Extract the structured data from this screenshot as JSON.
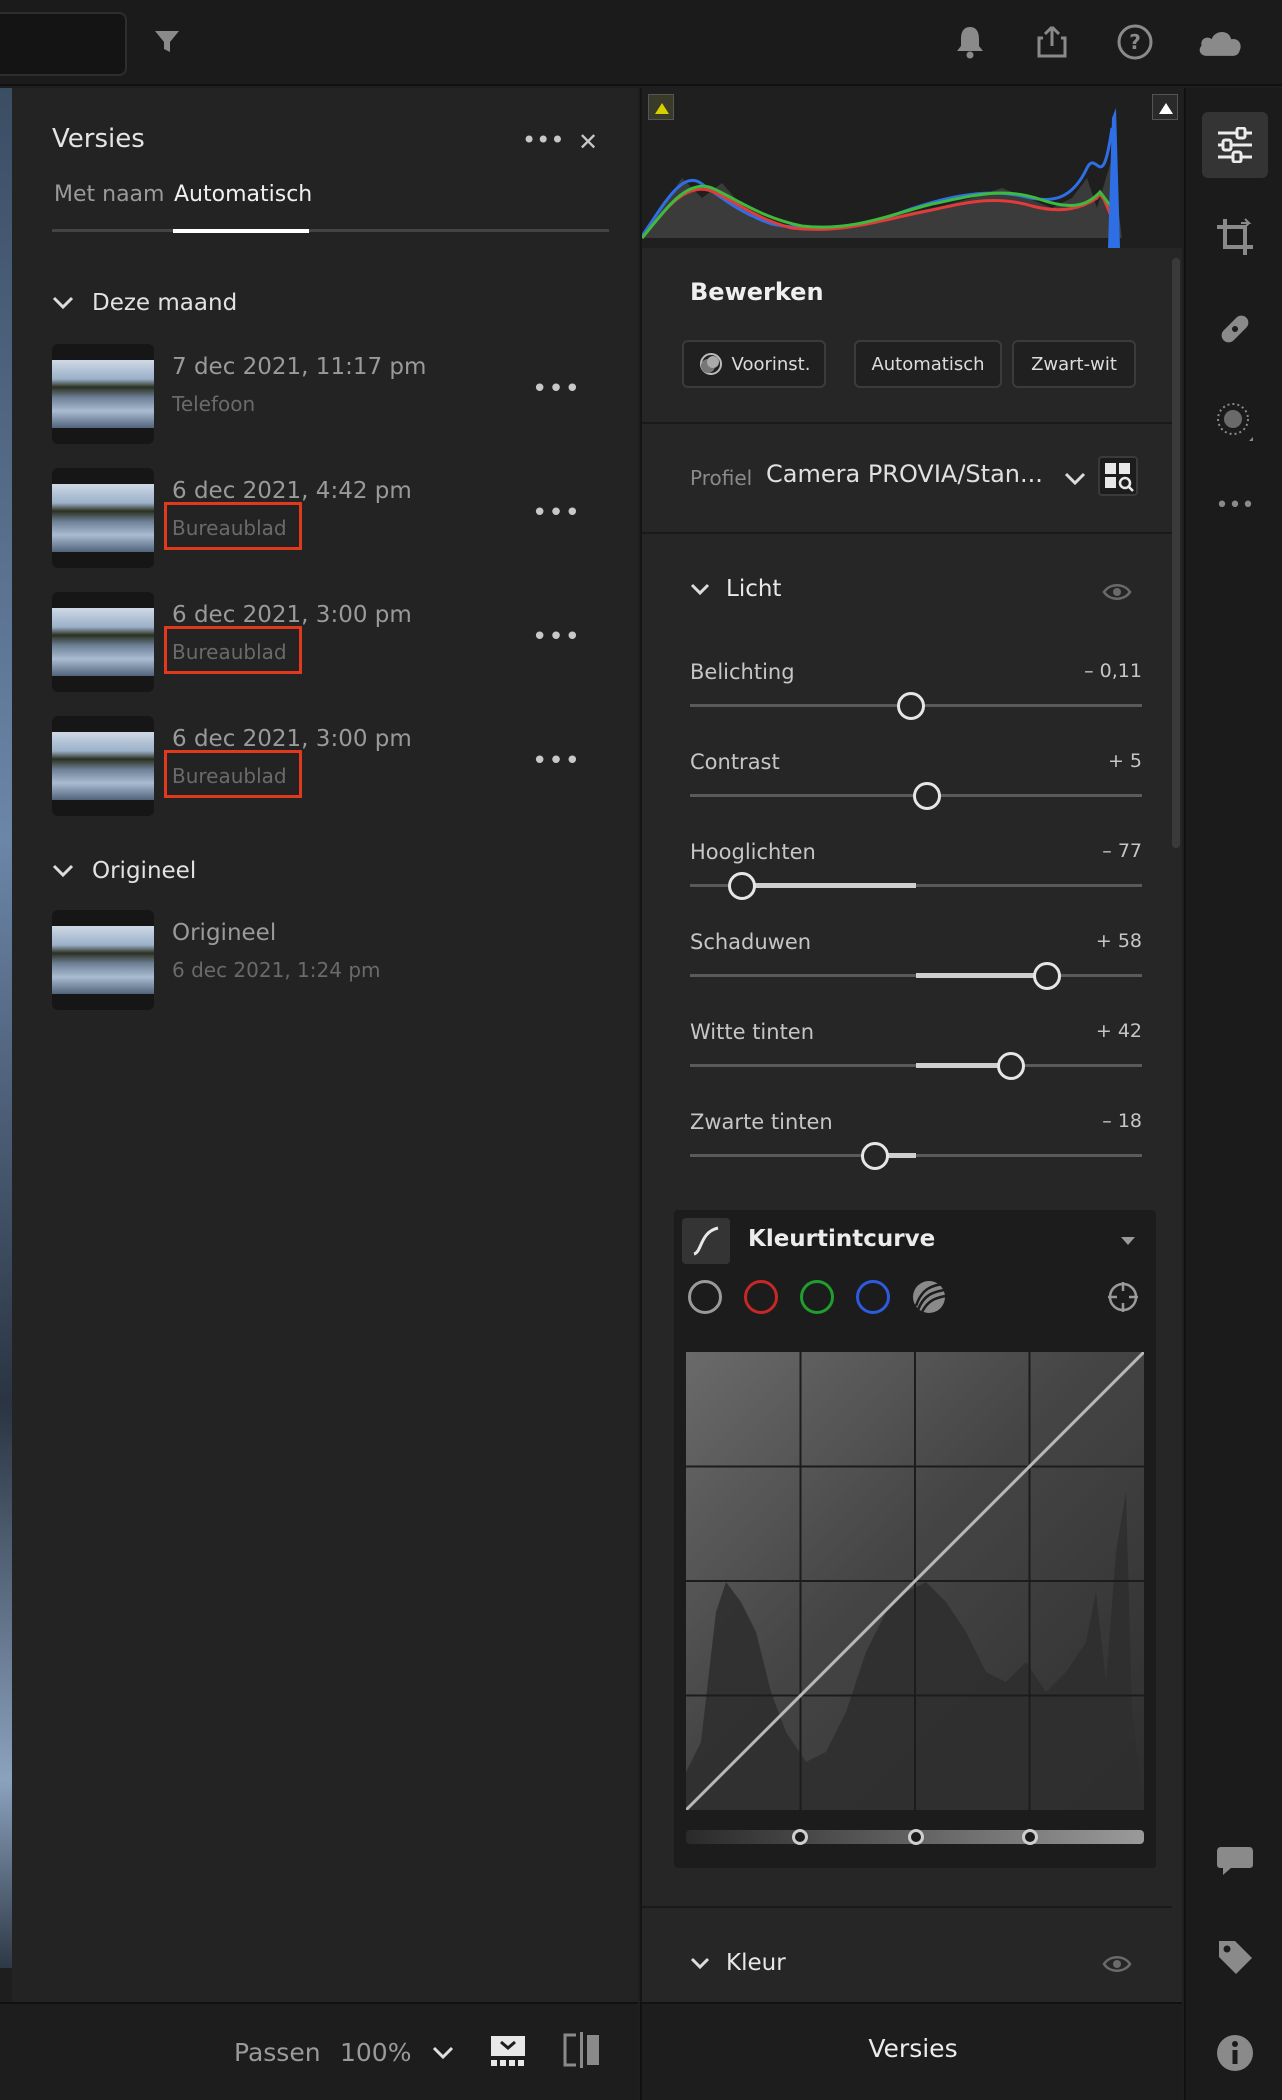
{
  "topbar": {
    "filter_icon": "filter-icon",
    "bell_icon": "bell-icon",
    "share_icon": "share-icon",
    "help_icon": "help-icon",
    "cloud_icon": "cloud-icon"
  },
  "versions": {
    "title": "Versies",
    "more": "•••",
    "close": "✕",
    "tabs": [
      "Met naam",
      "Automatisch"
    ],
    "active_tab": "Automatisch",
    "groups": [
      {
        "label": "Deze maand",
        "items": [
          {
            "date": "7 dec 2021, 11:17 pm",
            "source": "Telefoon",
            "highlighted": false
          },
          {
            "date": "6 dec 2021, 4:42 pm",
            "source": "Bureaublad",
            "highlighted": true
          },
          {
            "date": "6 dec 2021, 3:00 pm",
            "source": "Bureaublad",
            "highlighted": true
          },
          {
            "date": "6 dec 2021, 3:00 pm",
            "source": "Bureaublad",
            "highlighted": true
          }
        ]
      },
      {
        "label": "Origineel",
        "items": [
          {
            "date": "Origineel",
            "source": "6 dec 2021, 1:24 pm",
            "highlighted": false
          }
        ]
      }
    ]
  },
  "bottom_left": {
    "fit_label": "Passen",
    "zoom": "100%"
  },
  "edit": {
    "title": "Bewerken",
    "presets_label": "Voorinst.",
    "auto_label": "Automatisch",
    "bw_label": "Zwart-wit",
    "profile_label": "Profiel",
    "profile_value": "Camera PROVIA/Stan...",
    "light_label": "Licht",
    "sliders": [
      {
        "label": "Belichting",
        "value": "– 0,11",
        "num": -0.11,
        "min": -5,
        "max": 5
      },
      {
        "label": "Contrast",
        "value": "+ 5",
        "num": 5,
        "min": -100,
        "max": 100
      },
      {
        "label": "Hooglichten",
        "value": "– 77",
        "num": -77,
        "min": -100,
        "max": 100
      },
      {
        "label": "Schaduwen",
        "value": "+ 58",
        "num": 58,
        "min": -100,
        "max": 100
      },
      {
        "label": "Witte tinten",
        "value": "+ 42",
        "num": 42,
        "min": -100,
        "max": 100
      },
      {
        "label": "Zwarte tinten",
        "value": "– 18",
        "num": -18,
        "min": -100,
        "max": 100
      }
    ],
    "curve_label": "Kleurtintcurve",
    "curve_channels": [
      "#9a9a9a",
      "#c62828",
      "#1e9e2e",
      "#2d5be0"
    ],
    "color_label": "Kleur"
  },
  "bottom_right": {
    "versions_label": "Versies"
  },
  "tools": [
    "edit-sliders-icon",
    "crop-icon",
    "heal-icon",
    "mask-icon",
    "more-icon",
    "comment-icon",
    "tag-icon",
    "info-icon"
  ]
}
